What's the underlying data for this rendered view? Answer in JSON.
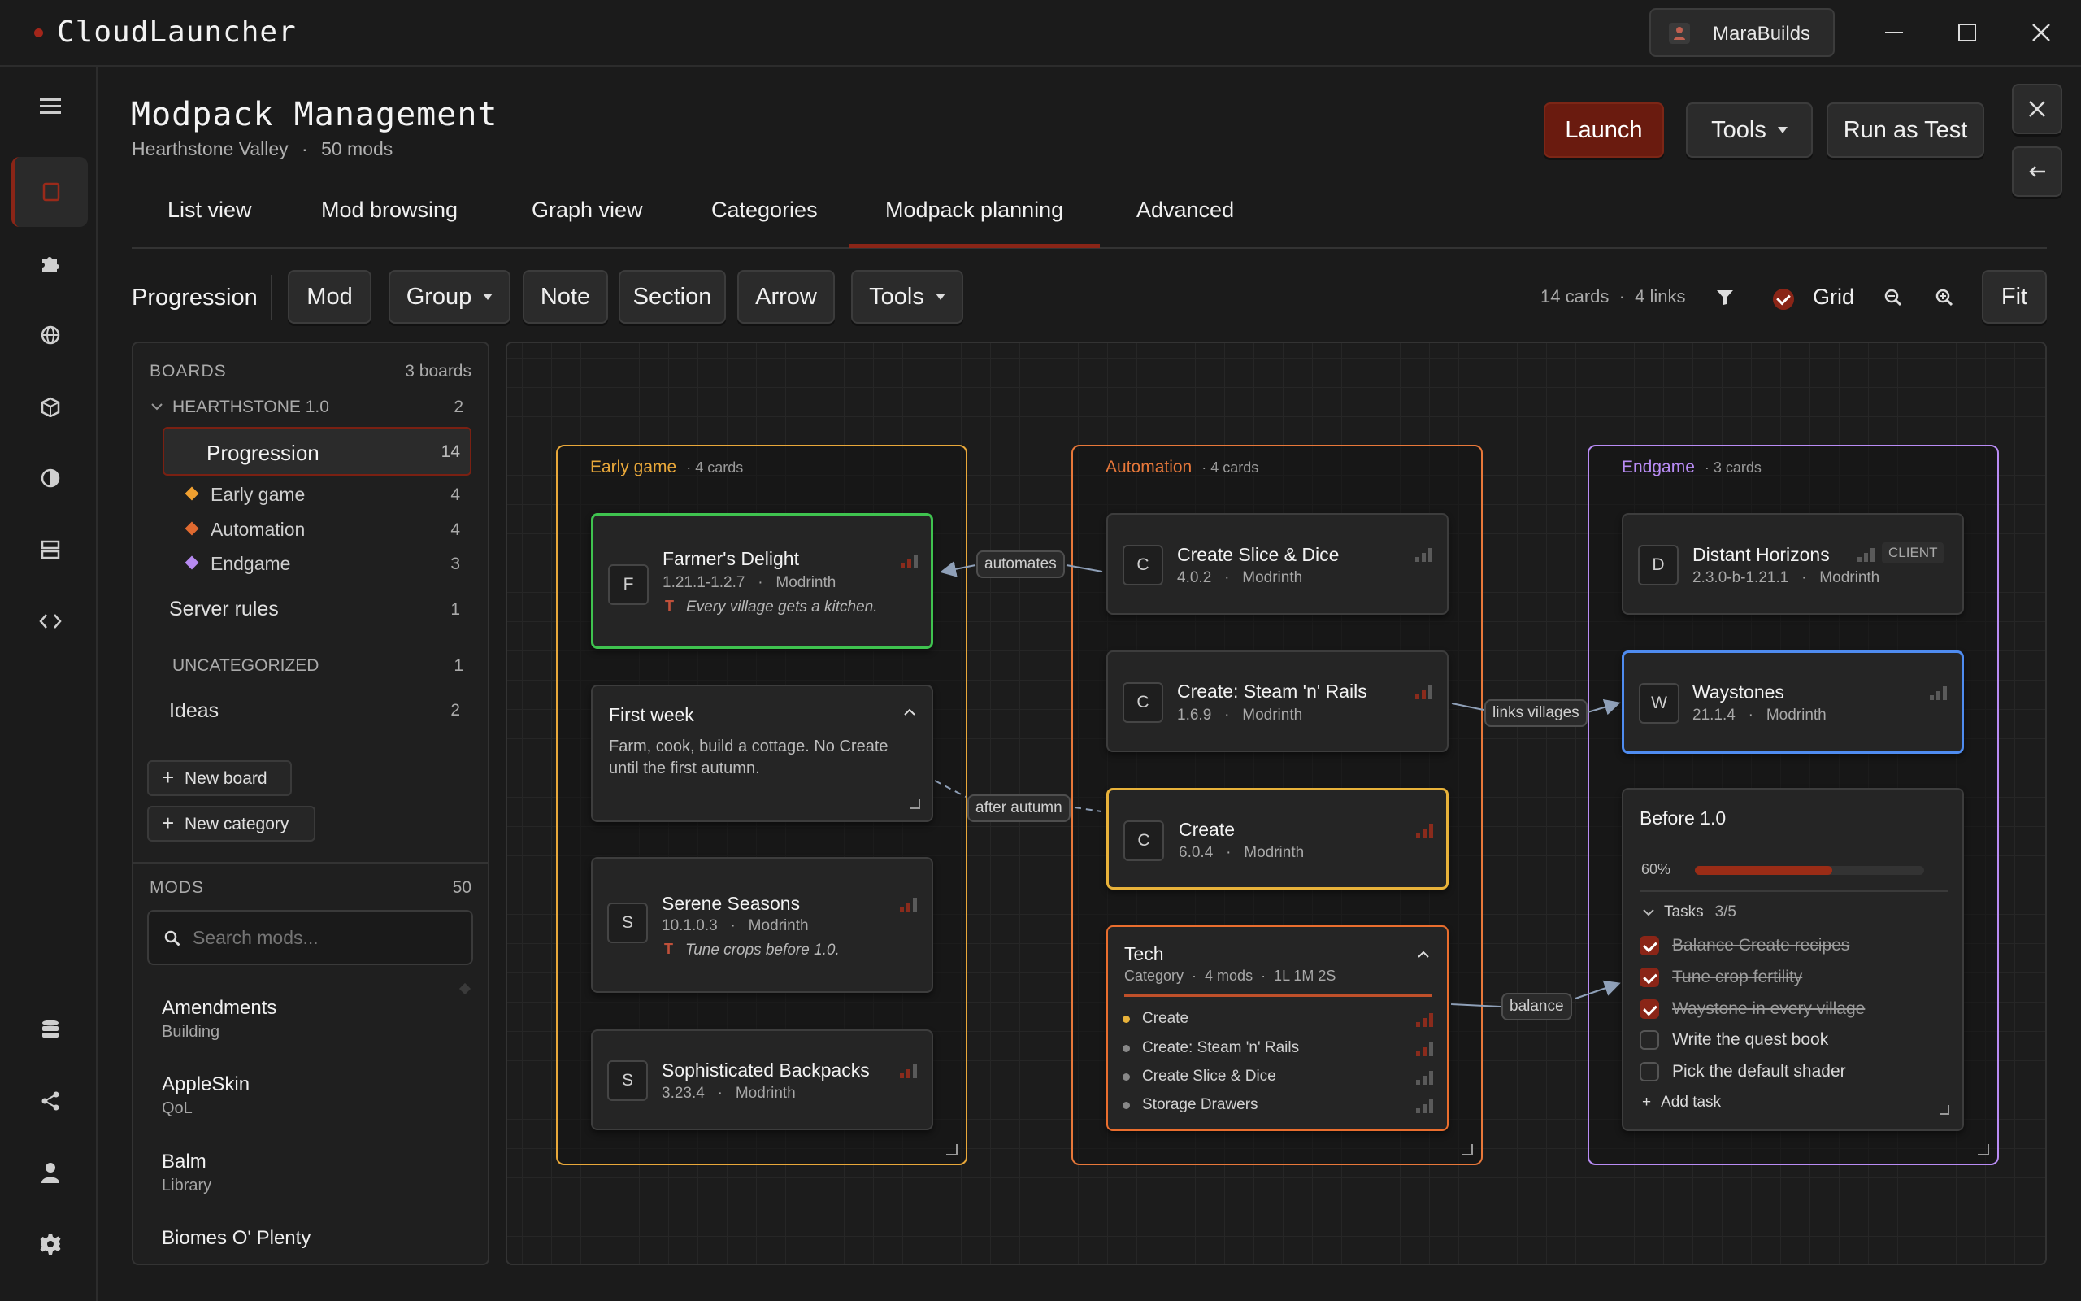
{
  "app": {
    "title": "CloudLauncher",
    "user": "MaraBuilds"
  },
  "header": {
    "title": "Modpack Management",
    "subtitle_pack": "Hearthstone Valley",
    "subtitle_sep": "·",
    "subtitle_mods": "50 mods"
  },
  "actions": {
    "launch": "Launch",
    "tools": "Tools",
    "run_test": "Run as Test"
  },
  "tabs": [
    "List view",
    "Mod browsing",
    "Graph view",
    "Categories",
    "Modpack planning",
    "Advanced"
  ],
  "toolbar": {
    "board": "Progression",
    "mod": "Mod",
    "group": "Group",
    "note": "Note",
    "section": "Section",
    "arrow": "Arrow",
    "tools": "Tools",
    "stats": "14 cards  ·  4 links",
    "grid": "Grid",
    "fit": "Fit"
  },
  "sidebar": {
    "boards_label": "BOARDS",
    "boards_count": "3 boards",
    "group1": {
      "name": "HEARTHSTONE 1.0",
      "count": "2"
    },
    "active_board": {
      "name": "Progression",
      "count": "14"
    },
    "sections": [
      {
        "name": "Early game",
        "count": "4",
        "color": "#f0a030"
      },
      {
        "name": "Automation",
        "count": "4",
        "color": "#e06a30"
      },
      {
        "name": "Endgame",
        "count": "3",
        "color": "#b68af0"
      }
    ],
    "server_rules": {
      "name": "Server rules",
      "count": "1"
    },
    "uncategorized": {
      "name": "UNCATEGORIZED",
      "count": "1"
    },
    "ideas": {
      "name": "Ideas",
      "count": "2"
    },
    "new_board": "New board",
    "new_category": "New category",
    "mods_label": "MODS",
    "mods_count": "50",
    "search_placeholder": "Search mods...",
    "mods": [
      {
        "name": "Amendments",
        "cat": "Building"
      },
      {
        "name": "AppleSkin",
        "cat": "QoL"
      },
      {
        "name": "Balm",
        "cat": "Library"
      },
      {
        "name": "Biomes O' Plenty",
        "cat": ""
      }
    ]
  },
  "canvas": {
    "early": {
      "title": "Early game",
      "count": "· 4 cards",
      "color": "#e9a83a"
    },
    "automation": {
      "title": "Automation",
      "count": "· 4 cards",
      "color": "#e8783a"
    },
    "endgame": {
      "title": "Endgame",
      "count": "· 3 cards",
      "color": "#b98cf5"
    },
    "farmers": {
      "badge": "F",
      "name": "Farmer's Delight",
      "meta": "1.21.1-1.2.7   ·   Modrinth",
      "note": "Every village gets a kitchen."
    },
    "firstweek": {
      "title": "First week",
      "text1": "Farm, cook, build a cottage. No Create",
      "text2": "until the first autumn."
    },
    "serene": {
      "badge": "S",
      "name": "Serene Seasons",
      "meta": "10.1.0.3   ·   Modrinth",
      "note": "Tune crops before 1.0."
    },
    "backpacks": {
      "badge": "S",
      "name": "Sophisticated Backpacks",
      "meta": "3.23.4   ·   Modrinth"
    },
    "slice": {
      "badge": "C",
      "name": "Create Slice & Dice",
      "meta": "4.0.2   ·   Modrinth"
    },
    "steam": {
      "badge": "C",
      "name": "Create: Steam 'n' Rails",
      "meta": "1.6.9   ·   Modrinth"
    },
    "create": {
      "badge": "C",
      "name": "Create",
      "meta": "6.0.4   ·   Modrinth"
    },
    "tech": {
      "title": "Tech",
      "meta": "Category  ·  4 mods  ·  1L 1M 2S",
      "items": [
        "Create",
        "Create: Steam 'n' Rails",
        "Create Slice & Dice",
        "Storage Drawers"
      ]
    },
    "horizons": {
      "badge": "D",
      "name": "Distant Horizons",
      "meta": "2.3.0-b-1.21.1   ·   Modrinth",
      "tag": "CLIENT"
    },
    "waystones": {
      "badge": "W",
      "name": "Waystones",
      "meta": "21.1.4   ·   Modrinth"
    },
    "before": {
      "title": "Before 1.0",
      "progress_label": "60%",
      "progress": 0.6,
      "tasks_label": "Tasks",
      "tasks_count": "3/5",
      "tasks": [
        {
          "text": "Balance Create recipes",
          "done": true
        },
        {
          "text": "Tune crop fertility",
          "done": true
        },
        {
          "text": "Waystone in every village",
          "done": true
        },
        {
          "text": "Write the quest book",
          "done": false
        },
        {
          "text": "Pick the default shader",
          "done": false
        }
      ],
      "add_task": "Add task"
    },
    "links": {
      "automates": "automates",
      "after_autumn": "after autumn",
      "links_villages": "links villages",
      "balance": "balance"
    }
  },
  "colors": {
    "accent": "#7a1f12",
    "green": "#3fc34f",
    "blue": "#4f8cf0",
    "yellow": "#e8b23a",
    "orange": "#ea6e2e"
  }
}
